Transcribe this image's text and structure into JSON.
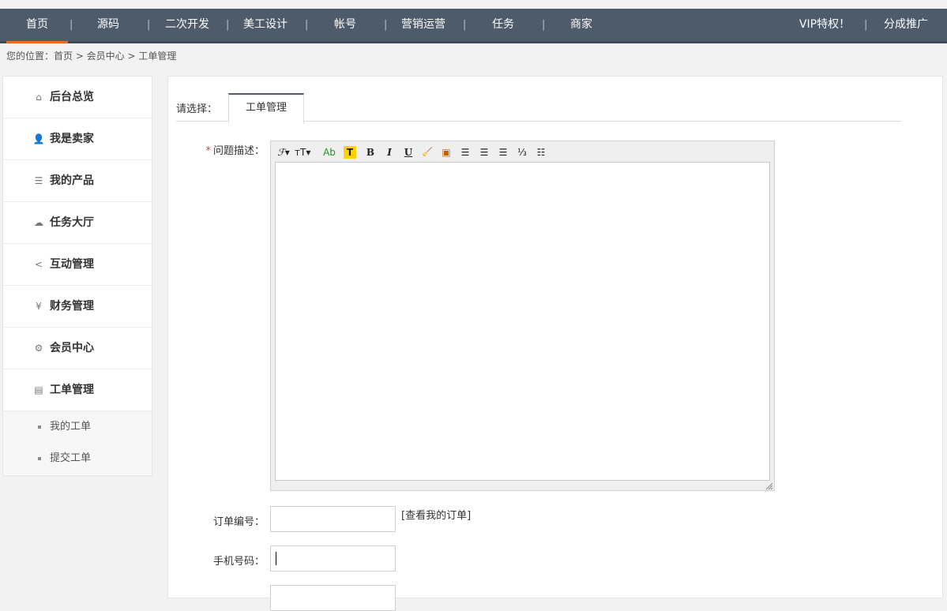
{
  "nav": {
    "items": [
      "首页",
      "源码",
      "二次开发",
      "美工设计",
      "帐号",
      "营销运营",
      "任务",
      "商家"
    ],
    "right_items": [
      "VIP特权！",
      "分成推广"
    ],
    "separator": "|",
    "accent": "#f06a1d",
    "bar_color": "#4d5b6b"
  },
  "breadcrumb": "您的位置：首页 > 会员中心 > 工单管理",
  "sidebar": {
    "items": [
      {
        "label": "后台总览",
        "icon": "home-icon",
        "glyph": "⌂"
      },
      {
        "label": "我是卖家",
        "icon": "user-icon",
        "glyph": "👤"
      },
      {
        "label": "我的产品",
        "icon": "server-icon",
        "glyph": "☰"
      },
      {
        "label": "任务大厅",
        "icon": "cloud-icon",
        "glyph": "☁"
      },
      {
        "label": "互动管理",
        "icon": "share-icon",
        "glyph": "<"
      },
      {
        "label": "财务管理",
        "icon": "yen-icon",
        "glyph": "¥"
      },
      {
        "label": "会员中心",
        "icon": "gears-icon",
        "glyph": "⚙"
      },
      {
        "label": "工单管理",
        "icon": "clipboard-icon",
        "glyph": "▤"
      }
    ],
    "sub_items": [
      "我的工单",
      "提交工单"
    ]
  },
  "main": {
    "choose_label": "请选择：",
    "active_tab": "工单管理",
    "form": {
      "desc_required_mark": "*",
      "desc_label": "问题描述：",
      "order_label": "订单编号：",
      "order_value": "",
      "view_orders_link": "[查看我的订单]",
      "phone_label": "手机号码：",
      "phone_value": ""
    },
    "toolbar": [
      {
        "name": "font-family-icon",
        "glyph": "ℱ▾"
      },
      {
        "name": "font-size-icon",
        "glyph": "тT▾"
      },
      {
        "name": "font-color-icon",
        "glyph": "Ab"
      },
      {
        "name": "highlight-icon",
        "glyph": "T"
      },
      {
        "name": "bold-icon",
        "glyph": "B"
      },
      {
        "name": "italic-icon",
        "glyph": "I"
      },
      {
        "name": "underline-icon",
        "glyph": "U"
      },
      {
        "name": "clear-format-icon",
        "glyph": "🧹"
      },
      {
        "name": "insert-image-icon",
        "glyph": "▣"
      },
      {
        "name": "align-left-icon",
        "glyph": "☰"
      },
      {
        "name": "align-center-icon",
        "glyph": "☰"
      },
      {
        "name": "align-right-icon",
        "glyph": "☰"
      },
      {
        "name": "ordered-list-icon",
        "glyph": "⅓"
      },
      {
        "name": "unordered-list-icon",
        "glyph": "☷"
      }
    ]
  }
}
